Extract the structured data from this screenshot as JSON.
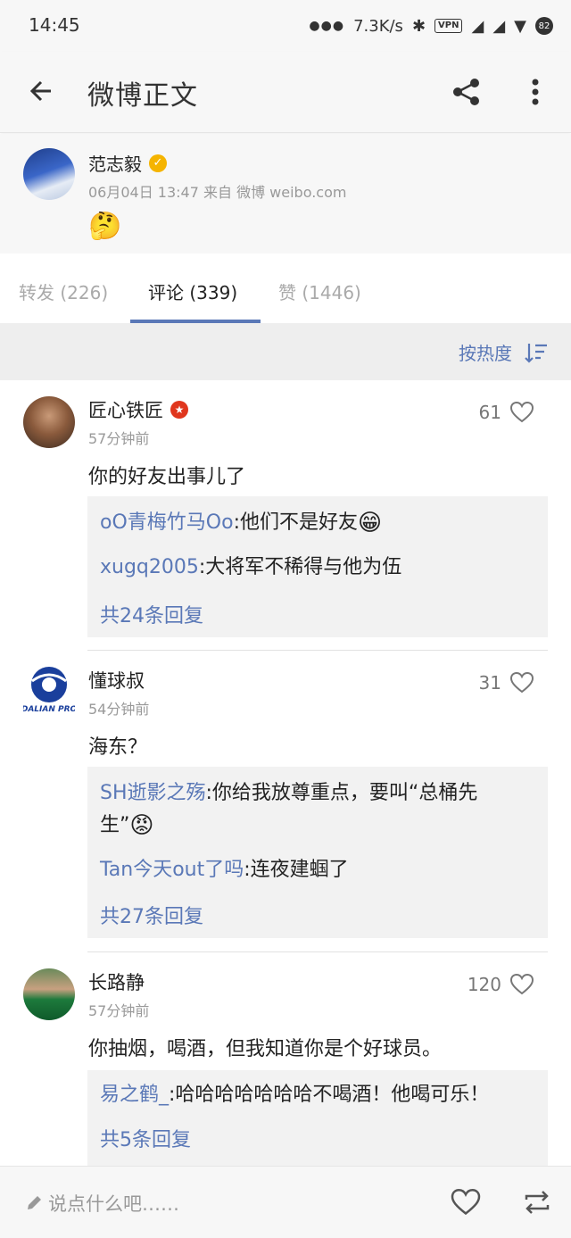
{
  "status_bar": {
    "time": "14:45",
    "net_speed": "7.3K/s",
    "vpn": "VPN",
    "battery": "82"
  },
  "appbar": {
    "title": "微博正文"
  },
  "post": {
    "author": "范志毅",
    "meta": "06月04日 13:47  来自 微博 weibo.com",
    "content_emoji": "🤔"
  },
  "tabs": [
    {
      "label": "转发 (226)"
    },
    {
      "label": "评论 (339)"
    },
    {
      "label": "赞 (1446)"
    }
  ],
  "sort": {
    "label": "按热度"
  },
  "comments": [
    {
      "name": "匠心铁匠",
      "time": "57分钟前",
      "likes": "61",
      "text": "你的好友出事儿了",
      "replies": [
        {
          "user": "oO青梅竹马Oo",
          "text": ":他们不是好友",
          "emoji": "😁"
        },
        {
          "user": "xugq2005",
          "text": ":大将军不稀得与他为伍"
        }
      ],
      "more": "共24条回复"
    },
    {
      "name": "懂球叔",
      "time": "54分钟前",
      "likes": "31",
      "text": "海东？",
      "avatar_text": "DALIAN PRO",
      "replies": [
        {
          "user": "SH逝影之殇",
          "text": ":你给我放尊重点，要叫“总桶先生”",
          "emoji": "😡"
        },
        {
          "user": "Tan今天out了吗",
          "text": ":连夜建蝈了"
        }
      ],
      "more": "共27条回复"
    },
    {
      "name": "长路静",
      "time": "57分钟前",
      "likes": "120",
      "text": "你抽烟，喝酒，但我知道你是个好球员。",
      "replies": [
        {
          "user": "易之鹤_",
          "text": ":哈哈哈哈哈哈哈不喝酒！他喝可乐！"
        }
      ],
      "more": "共5条回复"
    }
  ],
  "bottom_bar": {
    "input_hint": "说点什么吧……"
  },
  "colors": {
    "link": "#5a78b7",
    "verified": "#f5b400",
    "red_badge": "#e0361d"
  }
}
